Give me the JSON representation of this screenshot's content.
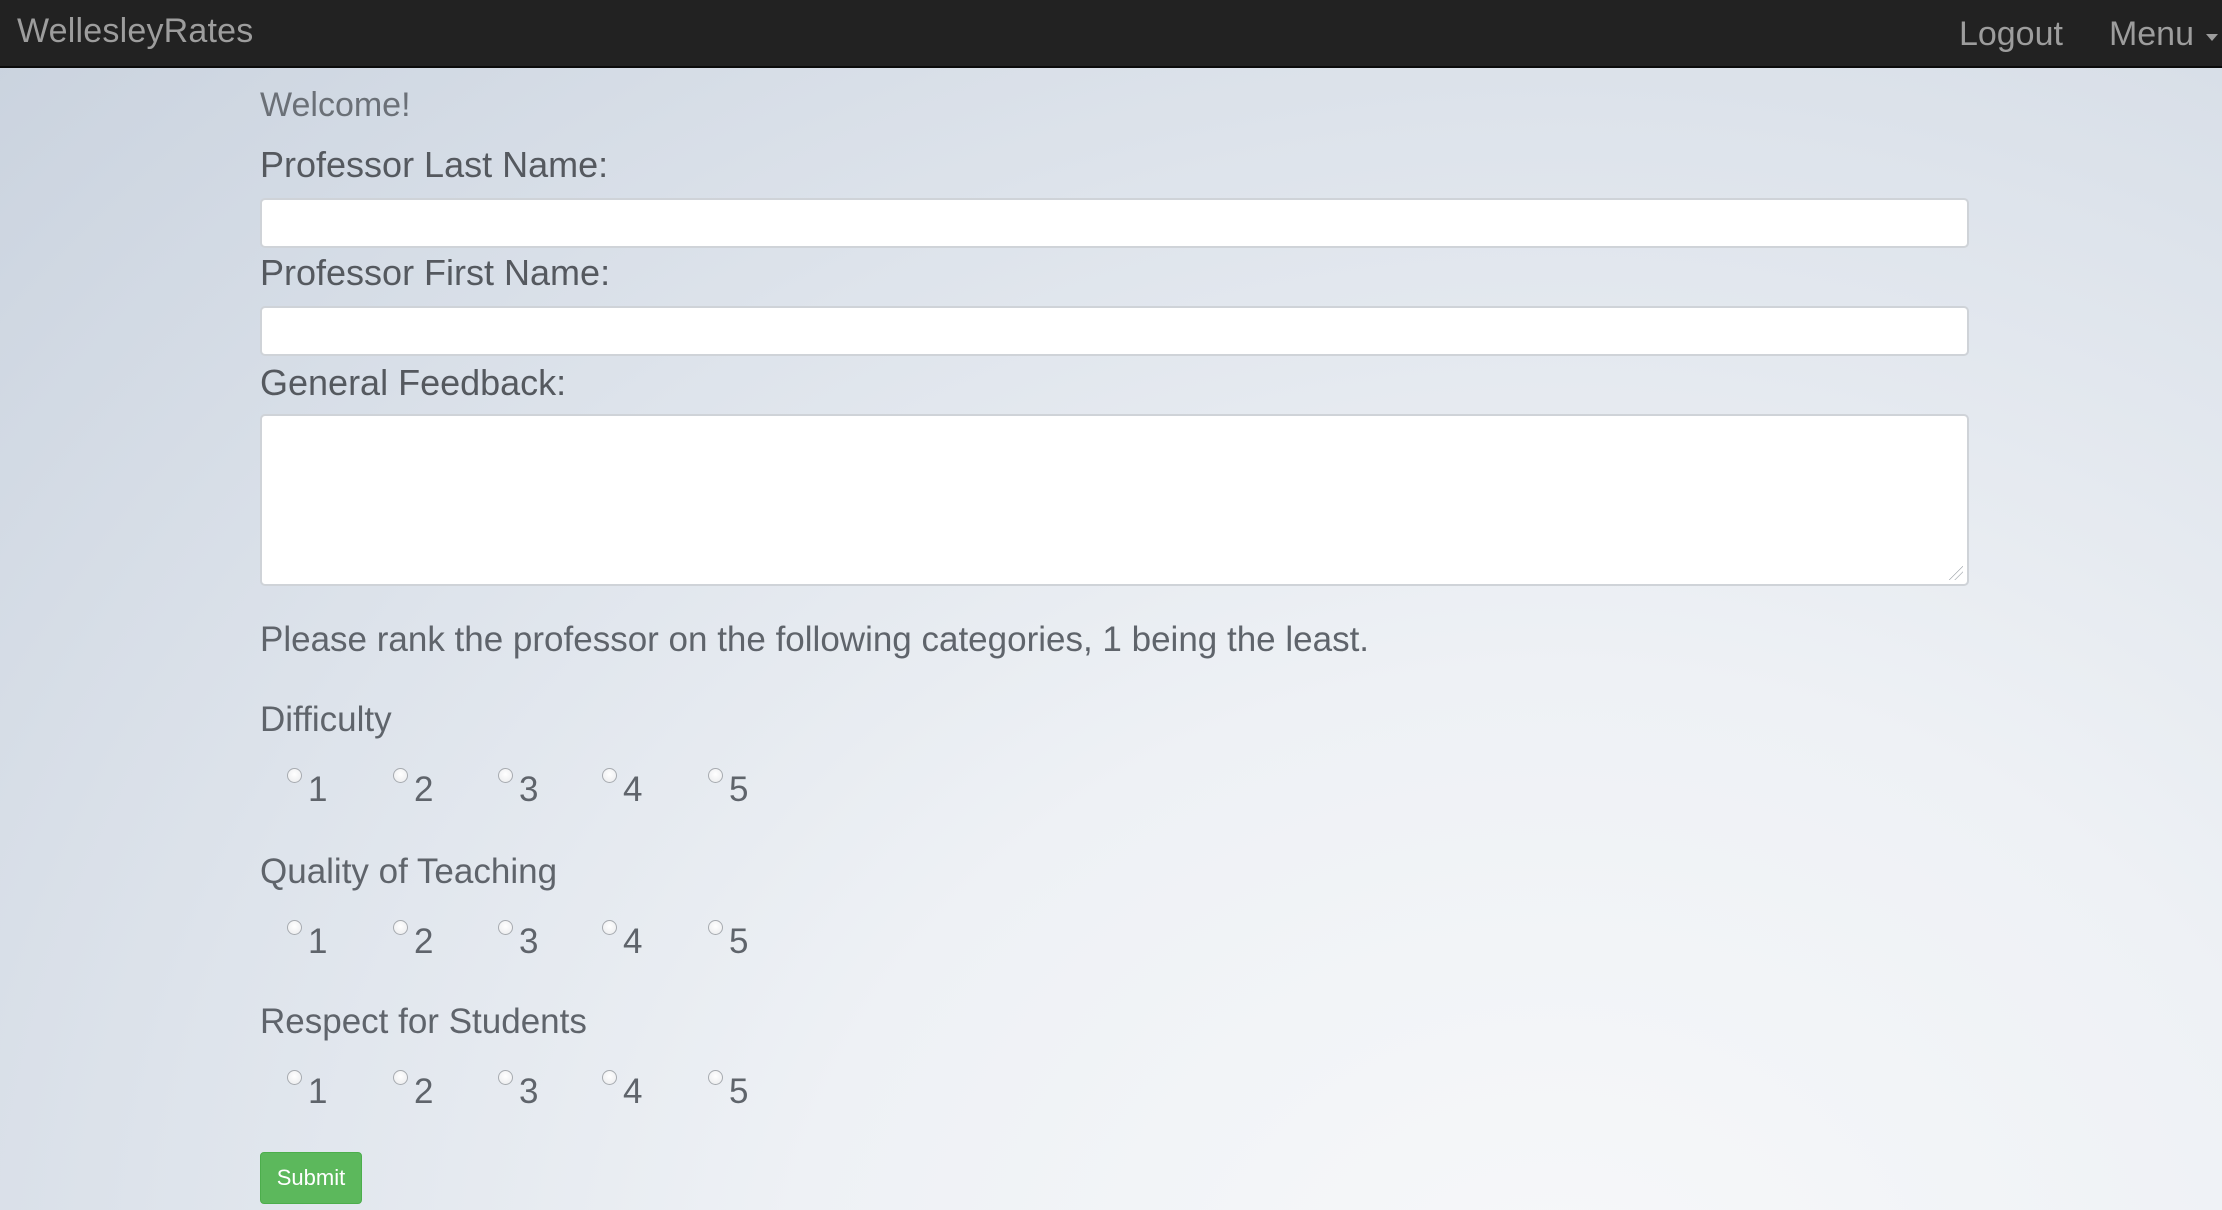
{
  "navbar": {
    "brand": "WellesleyRates",
    "logout_label": "Logout",
    "menu_label": "Menu"
  },
  "form": {
    "welcome": "Welcome!",
    "last_name_label": "Professor Last Name:",
    "last_name_value": "",
    "first_name_label": "Professor First Name:",
    "first_name_value": "",
    "feedback_label": "General Feedback:",
    "feedback_value": "",
    "instruction": "Please rank the professor on the following categories, 1 being the least.",
    "categories": [
      {
        "name": "Difficulty",
        "options": [
          "1",
          "2",
          "3",
          "4",
          "5"
        ],
        "selected": null
      },
      {
        "name": "Quality of Teaching",
        "options": [
          "1",
          "2",
          "3",
          "4",
          "5"
        ],
        "selected": null
      },
      {
        "name": "Respect for Students",
        "options": [
          "1",
          "2",
          "3",
          "4",
          "5"
        ],
        "selected": null
      }
    ],
    "submit_label": "Submit"
  },
  "colors": {
    "navbar_bg": "#222222",
    "nav_text": "#9d9d9d",
    "submit_bg": "#5cb85c"
  }
}
